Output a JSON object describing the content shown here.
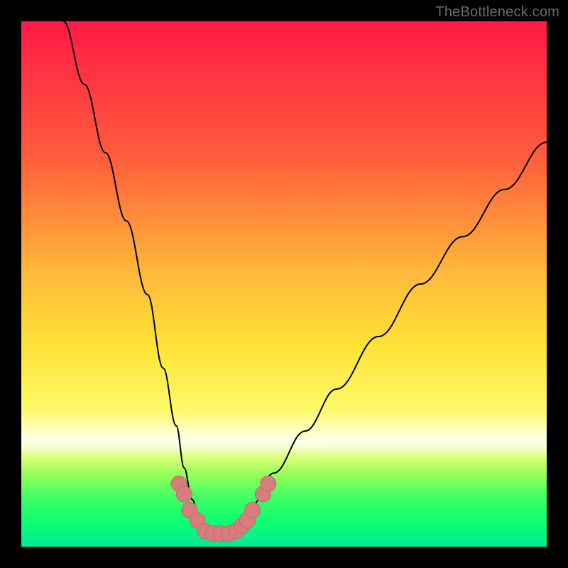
{
  "watermark": "TheBottleneck.com",
  "chart_data": {
    "type": "line",
    "title": "",
    "xlabel": "",
    "ylabel": "",
    "xlim": [
      0,
      100
    ],
    "ylim": [
      0,
      100
    ],
    "x": [
      8,
      12,
      16,
      20,
      24,
      27,
      29.5,
      31,
      32.5,
      34,
      35.5,
      37,
      38.5,
      40,
      42,
      44,
      48,
      54,
      60,
      68,
      76,
      84,
      92,
      100
    ],
    "values": [
      100,
      88,
      75,
      62,
      48,
      34,
      23,
      15,
      9,
      5,
      3,
      2,
      2,
      3,
      5,
      8,
      14,
      22,
      30,
      40,
      50,
      59,
      68,
      77
    ],
    "markers": {
      "x": [
        30,
        31,
        32,
        33.5,
        35,
        36.5,
        38,
        39.5,
        41,
        42,
        43,
        44,
        46,
        47
      ],
      "y": [
        12,
        10,
        7,
        5,
        3,
        2.5,
        2.5,
        2.5,
        3,
        4,
        5,
        7,
        10,
        12
      ]
    },
    "colors": {
      "curve": "#000000",
      "marker_fill": "#d77d7d",
      "marker_stroke": "#c26a6a"
    }
  }
}
